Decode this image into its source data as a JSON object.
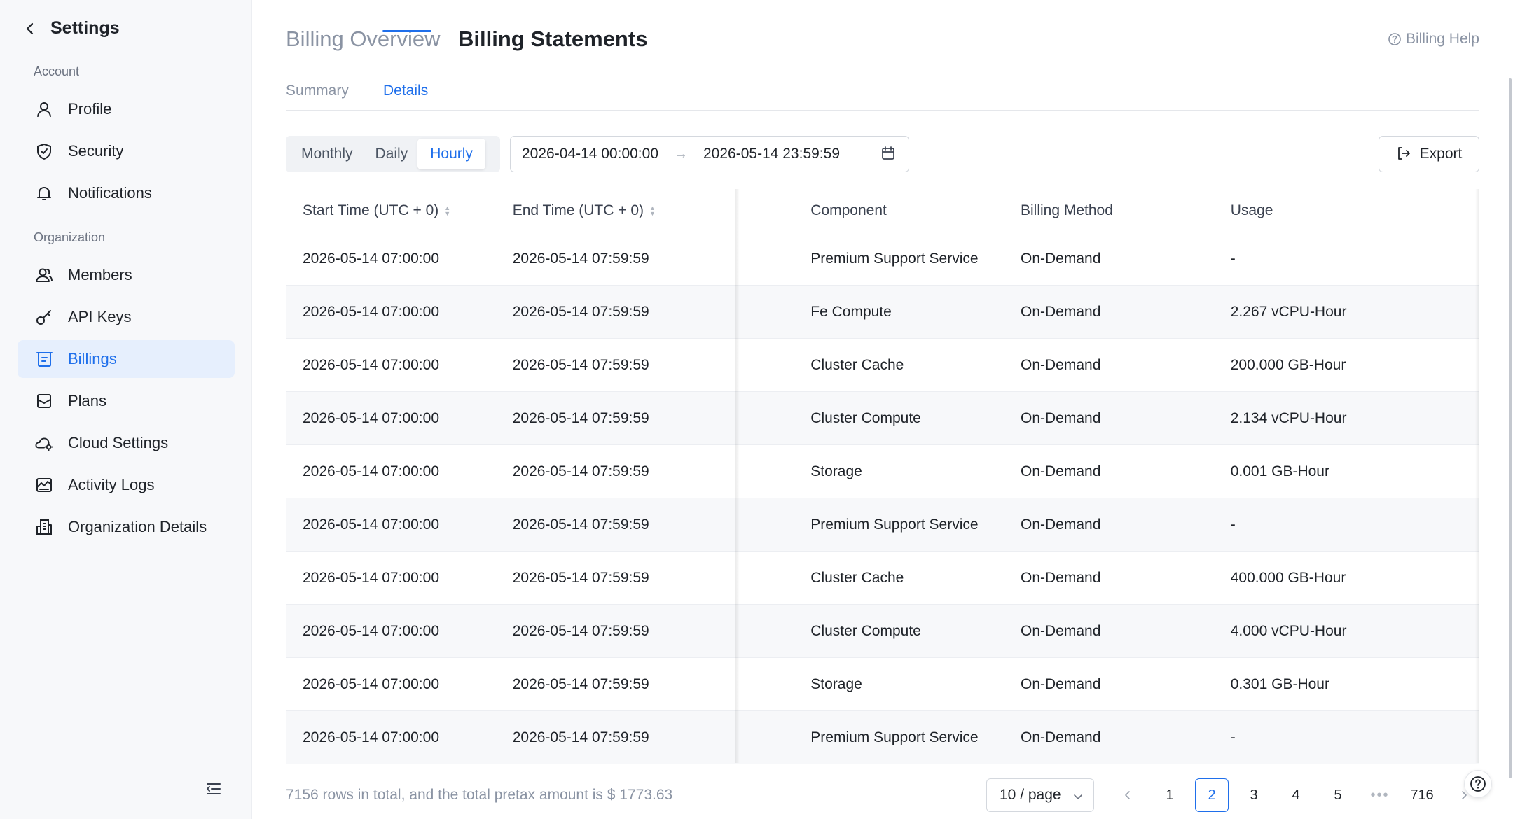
{
  "sidebar": {
    "title": "Settings",
    "groups": {
      "account": "Account",
      "organization": "Organization"
    },
    "items": [
      {
        "label": "Profile",
        "icon": "user-icon"
      },
      {
        "label": "Security",
        "icon": "shield-icon"
      },
      {
        "label": "Notifications",
        "icon": "bell-icon"
      },
      {
        "label": "Members",
        "icon": "members-icon"
      },
      {
        "label": "API Keys",
        "icon": "key-icon"
      },
      {
        "label": "Billings",
        "icon": "billing-icon",
        "active": true
      },
      {
        "label": "Plans",
        "icon": "plans-icon"
      },
      {
        "label": "Cloud Settings",
        "icon": "cloud-settings-icon"
      },
      {
        "label": "Activity Logs",
        "icon": "activity-icon"
      },
      {
        "label": "Organization Details",
        "icon": "building-icon"
      }
    ]
  },
  "header": {
    "title_secondary": "Billing Overview",
    "title_primary": "Billing Statements",
    "help": "Billing Help"
  },
  "tabs": {
    "summary": "Summary",
    "details": "Details",
    "active": "Details"
  },
  "toolbar": {
    "granularity": [
      "Monthly",
      "Daily",
      "Hourly"
    ],
    "granularity_selected": "Hourly",
    "range_start": "2026-04-14 00:00:00",
    "range_end": "2026-05-14 23:59:59",
    "export_label": "Export"
  },
  "table": {
    "columns": {
      "start": "Start Time (UTC + 0)",
      "end": "End Time (UTC + 0)",
      "component": "Component",
      "billing_method": "Billing Method",
      "usage": "Usage"
    },
    "rows": [
      {
        "start": "2026-05-14 07:00:00",
        "end": "2026-05-14 07:59:59",
        "component": "Premium Support Service",
        "method": "On-Demand",
        "usage": "-"
      },
      {
        "start": "2026-05-14 07:00:00",
        "end": "2026-05-14 07:59:59",
        "component": "Fe Compute",
        "method": "On-Demand",
        "usage": "2.267 vCPU-Hour"
      },
      {
        "start": "2026-05-14 07:00:00",
        "end": "2026-05-14 07:59:59",
        "component": "Cluster Cache",
        "method": "On-Demand",
        "usage": "200.000 GB-Hour"
      },
      {
        "start": "2026-05-14 07:00:00",
        "end": "2026-05-14 07:59:59",
        "component": "Cluster Compute",
        "method": "On-Demand",
        "usage": "2.134 vCPU-Hour"
      },
      {
        "start": "2026-05-14 07:00:00",
        "end": "2026-05-14 07:59:59",
        "component": "Storage",
        "method": "On-Demand",
        "usage": "0.001 GB-Hour"
      },
      {
        "start": "2026-05-14 07:00:00",
        "end": "2026-05-14 07:59:59",
        "component": "Premium Support Service",
        "method": "On-Demand",
        "usage": "-"
      },
      {
        "start": "2026-05-14 07:00:00",
        "end": "2026-05-14 07:59:59",
        "component": "Cluster Cache",
        "method": "On-Demand",
        "usage": "400.000 GB-Hour"
      },
      {
        "start": "2026-05-14 07:00:00",
        "end": "2026-05-14 07:59:59",
        "component": "Cluster Compute",
        "method": "On-Demand",
        "usage": "4.000 vCPU-Hour"
      },
      {
        "start": "2026-05-14 07:00:00",
        "end": "2026-05-14 07:59:59",
        "component": "Storage",
        "method": "On-Demand",
        "usage": "0.301 GB-Hour"
      },
      {
        "start": "2026-05-14 07:00:00",
        "end": "2026-05-14 07:59:59",
        "component": "Premium Support Service",
        "method": "On-Demand",
        "usage": "-"
      }
    ]
  },
  "footer": {
    "summary": "7156 rows in total, and the total pretax amount is $ 1773.63",
    "page_size": "10 / page",
    "pages": [
      "1",
      "2",
      "3",
      "4",
      "5"
    ],
    "ellipsis": "•••",
    "last_page": "716",
    "current_page": "2"
  },
  "colors": {
    "accent": "#1f6feb",
    "active_bg": "#e6effd",
    "sidebar_bg": "#f7f8fa"
  }
}
